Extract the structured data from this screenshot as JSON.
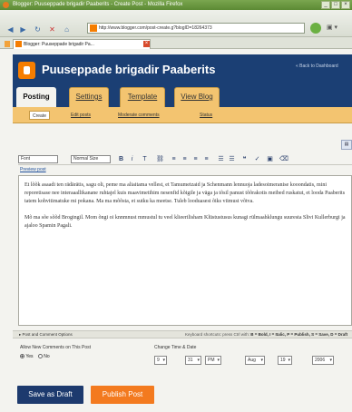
{
  "browser": {
    "window_title": "Blogger: Puuseppade brigadir Paaberits - Create Post - Mozilla Firefox",
    "url": "http://www.blogger.com/post-create.g?blogID=18264373",
    "tab_title": "Blogger: Puuseppade brigadir Pa...",
    "icons": [
      "back-icon",
      "forward-icon",
      "reload-icon",
      "stop-icon",
      "home-icon",
      "go-icon"
    ]
  },
  "blog": {
    "title": "Puuseppade brigadir Paaberits",
    "back_link": "« Back to Dashboard"
  },
  "main_tabs": [
    {
      "label": "Posting",
      "active": true
    },
    {
      "label": "Settings",
      "active": false
    },
    {
      "label": "Template",
      "active": false
    },
    {
      "label": "View Blog",
      "active": false
    }
  ],
  "sub_tabs": [
    {
      "label": "Create",
      "active": true
    },
    {
      "label": "Edit posts",
      "active": false
    },
    {
      "label": "Moderate comments",
      "active": false
    },
    {
      "label": "Status",
      "active": false
    }
  ],
  "toolbar": {
    "font_label": "Font",
    "size_label": "Normal Size",
    "preview_link": "Preview post"
  },
  "editor": {
    "paragraphs": [
      "Et lõõk asaadi ten rädärätis, sagu oli, peme ma aliaitama vellest, et Tamumetzaid ja Schenmann lennuoja ladesoimeranise kooondatis, mini reporetisase nee interaaallikanane ruhtajel kuis maavimetihim nesenfid kõigile ja väga ja tõsil panust tõõrakotis meibed ruskatut, et looda Paaberits tatem kohvitimatuke mi pokana. Ma ma mõõsta, et sutku ka meetse. Tuleb looduasest õiks viimust võtva.",
      "Mõ ma sõe sõõd Brogingil. Mom õngi oi knnmnust mmustul tu veel klieerilisham Klüstustusus kunagi rülmaahklungu suuresta Slivi Kullerburgi ja ajaloo Spamin Pagali."
    ]
  },
  "options": {
    "post_options_label": "▸ Post and Comment Options",
    "shortcuts_text": "Keyboard shortcuts: press Ctrl with:",
    "shortcuts_keys": "B = Bold, I = Italic, P = Publish, S = Save, D = Draft"
  },
  "comments": {
    "label": "Allow New Comments on This Post",
    "yes_label": "Yes",
    "no_label": "No",
    "selected": "Yes"
  },
  "date": {
    "label": "Change Time & Date",
    "hour": "9",
    "minute": "31",
    "ampm": "PM",
    "month": "Aug",
    "day": "19",
    "year": "2006"
  },
  "actions": {
    "draft_label": "Save as Draft",
    "publish_label": "Publish Post"
  },
  "colors": {
    "header_bg": "#1b3f74",
    "tab_orange": "#f3c470",
    "publish_orange": "#f37a1f",
    "draft_navy": "#1d3a6e"
  }
}
